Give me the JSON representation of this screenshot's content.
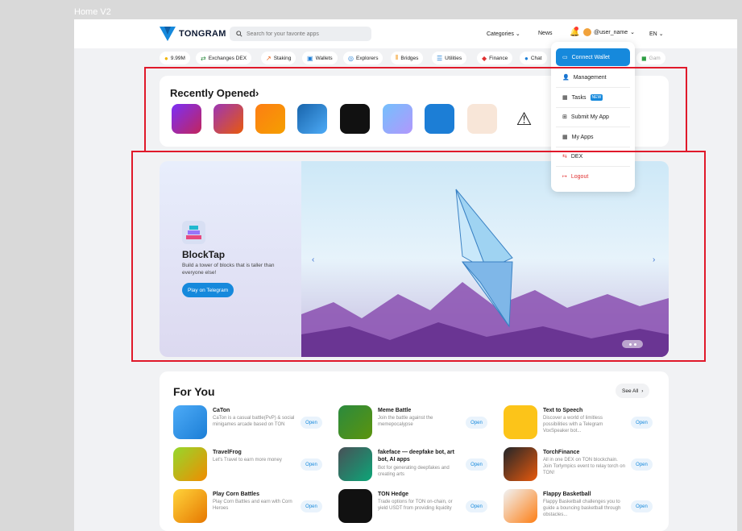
{
  "frame_title": "Home V2",
  "header": {
    "logo_text": "TONGRAM",
    "search_placeholder": "Search for your favorite apps",
    "categories": "Categories",
    "news": "News",
    "user_name": "@user_name",
    "lang": "EN"
  },
  "categories": [
    {
      "label": "9.99M",
      "icon": "coin-icon"
    },
    {
      "label": "Exchanges DEX",
      "icon": "exchange-icon"
    },
    {
      "label": "Staking",
      "icon": "staking-icon"
    },
    {
      "label": "Wallets",
      "icon": "wallet-icon"
    },
    {
      "label": "Explorers",
      "icon": "explorer-icon"
    },
    {
      "label": "Bridges",
      "icon": "bridge-icon"
    },
    {
      "label": "Utilities",
      "icon": "utilities-icon"
    },
    {
      "label": "Finance",
      "icon": "finance-icon"
    },
    {
      "label": "Chat",
      "icon": "chat-icon"
    },
    {
      "label": "Gam",
      "icon": "games-icon"
    }
  ],
  "recently_opened": {
    "title": "Recently Opened"
  },
  "user_menu": {
    "connect_wallet": "Connect Wallet",
    "management": "Management",
    "tasks": "Tasks",
    "tasks_badge": "NEW",
    "submit_app": "Submit My App",
    "my_apps": "My Apps",
    "dex": "DEX",
    "logout": "Logout"
  },
  "banner": {
    "app_name": "BlockTap",
    "description": "Build a tower of blocks that is taller than everyone else!",
    "cta": "Play on Telegram"
  },
  "for_you": {
    "title": "For You",
    "see_all": "See All",
    "open_label": "Open",
    "items": [
      {
        "name": "CaTon",
        "desc": "CaTon is a casual battle(PvP) & social minigames arcade based on TON"
      },
      {
        "name": "Meme Battle",
        "desc": "Join the battle against the memepocalypse"
      },
      {
        "name": "Text to Speech",
        "desc": "Discover a world of limitless possibilities with a Telegram VoxSpeaker bot..."
      },
      {
        "name": "TravelFrog",
        "desc": "Let's Travel to earn more money"
      },
      {
        "name": "fakeface — deepfake bot, art bot, AI apps",
        "desc": "Bot for generating deepfakes and creating arts"
      },
      {
        "name": "TorchFinance",
        "desc": "All in one DEX on TON blockchain. Join Torlympics event to relay torch on TON!"
      },
      {
        "name": "Play Corn Battles",
        "desc": "Play Corn Battles and earn with Corn Heroes"
      },
      {
        "name": "TON Hedge",
        "desc": "Trade options for TON on-chain, or yield USDT from providing liquidity"
      },
      {
        "name": "Flappy Basketball",
        "desc": "Flappy Basketball challenges you to guide a bouncing basketball through obstacles..."
      }
    ]
  },
  "colors": {
    "accent": "#1689dc",
    "highlight": "#e0192a"
  }
}
